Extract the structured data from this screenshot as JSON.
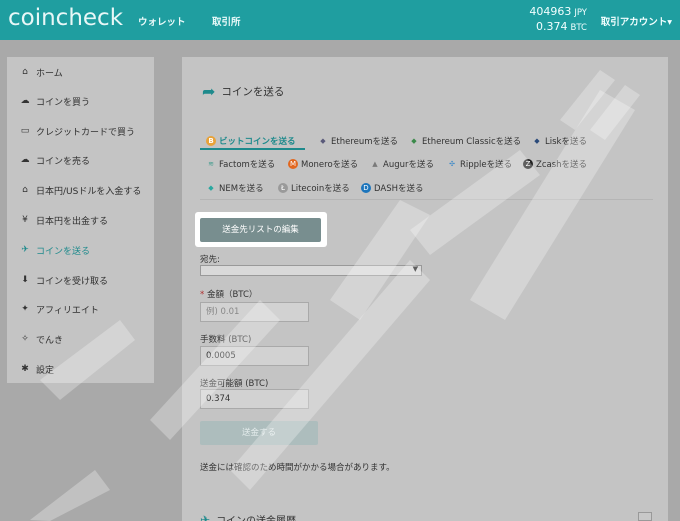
{
  "header": {
    "logo": "coincheck",
    "nav": [
      "ウォレット",
      "取引所"
    ],
    "balance_jpy": "404963",
    "unit_jpy": "JPY",
    "balance_btc": "0.374",
    "unit_btc": "BTC",
    "account": "取引アカウント▾"
  },
  "sidebar": {
    "items": [
      {
        "label": "ホーム",
        "icon": "home-icon",
        "glyph": "⌂"
      },
      {
        "label": "コインを買う",
        "icon": "cloud-download-icon",
        "glyph": "☁"
      },
      {
        "label": "クレジットカードで買う",
        "icon": "credit-card-icon",
        "glyph": "▭"
      },
      {
        "label": "コインを売る",
        "icon": "cloud-upload-icon",
        "glyph": "☁"
      },
      {
        "label": "日本円/USドルを入金する",
        "icon": "bank-icon",
        "glyph": "⌂"
      },
      {
        "label": "日本円を出金する",
        "icon": "yen-icon",
        "glyph": "¥"
      },
      {
        "label": "コインを送る",
        "icon": "send-icon",
        "glyph": "✈"
      },
      {
        "label": "コインを受け取る",
        "icon": "download-icon",
        "glyph": "⬇"
      },
      {
        "label": "アフィリエイト",
        "icon": "gift-icon",
        "glyph": "✦"
      },
      {
        "label": "でんき",
        "icon": "lightbulb-icon",
        "glyph": "✧"
      },
      {
        "label": "設定",
        "icon": "gear-icon",
        "glyph": "✱"
      }
    ]
  },
  "main": {
    "title": "コインを送る",
    "coins": [
      {
        "label": "ビットコインを送る",
        "icon": "bitcoin-icon",
        "glyph": "B",
        "color": "#e8a33a"
      },
      {
        "label": "Ethereumを送る",
        "icon": "ethereum-icon",
        "glyph": "◆",
        "color": "#5a5a7a"
      },
      {
        "label": "Ethereum Classicを送る",
        "icon": "ethereum-classic-icon",
        "glyph": "◆",
        "color": "#3b8a4a"
      },
      {
        "label": "Liskを送る",
        "icon": "lisk-icon",
        "glyph": "◆",
        "color": "#2a4a7a"
      },
      {
        "label": "Factomを送る",
        "icon": "factom-icon",
        "glyph": "≋",
        "color": "#3a9a8a"
      },
      {
        "label": "Moneroを送る",
        "icon": "monero-icon",
        "glyph": "M",
        "color": "#e2671e"
      },
      {
        "label": "Augurを送る",
        "icon": "augur-icon",
        "glyph": "▲",
        "color": "#7a7a7a"
      },
      {
        "label": "Rippleを送る",
        "icon": "ripple-icon",
        "glyph": "✣",
        "color": "#3a88c8"
      },
      {
        "label": "Zcashを送る",
        "icon": "zcash-icon",
        "glyph": "Z",
        "color": "#222222"
      },
      {
        "label": "NEMを送る",
        "icon": "nem-icon",
        "glyph": "◆",
        "color": "#2aa8a0"
      },
      {
        "label": "Litecoinを送る",
        "icon": "litecoin-icon",
        "glyph": "Ł",
        "color": "#9a9a9a"
      },
      {
        "label": "DASHを送る",
        "icon": "dash-icon",
        "glyph": "D",
        "color": "#1c75bc"
      }
    ],
    "edit_list_button": "送金先リストの編集",
    "destination_label": "宛先:",
    "amount_required": "*",
    "amount_label": "金額（BTC）",
    "amount_placeholder": "例) 0.01",
    "fee_label": "手数料 (BTC)",
    "fee_value": "0.0005",
    "available_label": "送金可能額 (BTC)",
    "available_value": "0.374",
    "send_button": "送金する",
    "note": "送金には確認のため時間がかかる場合があります。",
    "history_title": "コインの送金履歴"
  },
  "colors": {
    "accent": "#1f9ea0",
    "highlight_button": "#788e8f"
  }
}
